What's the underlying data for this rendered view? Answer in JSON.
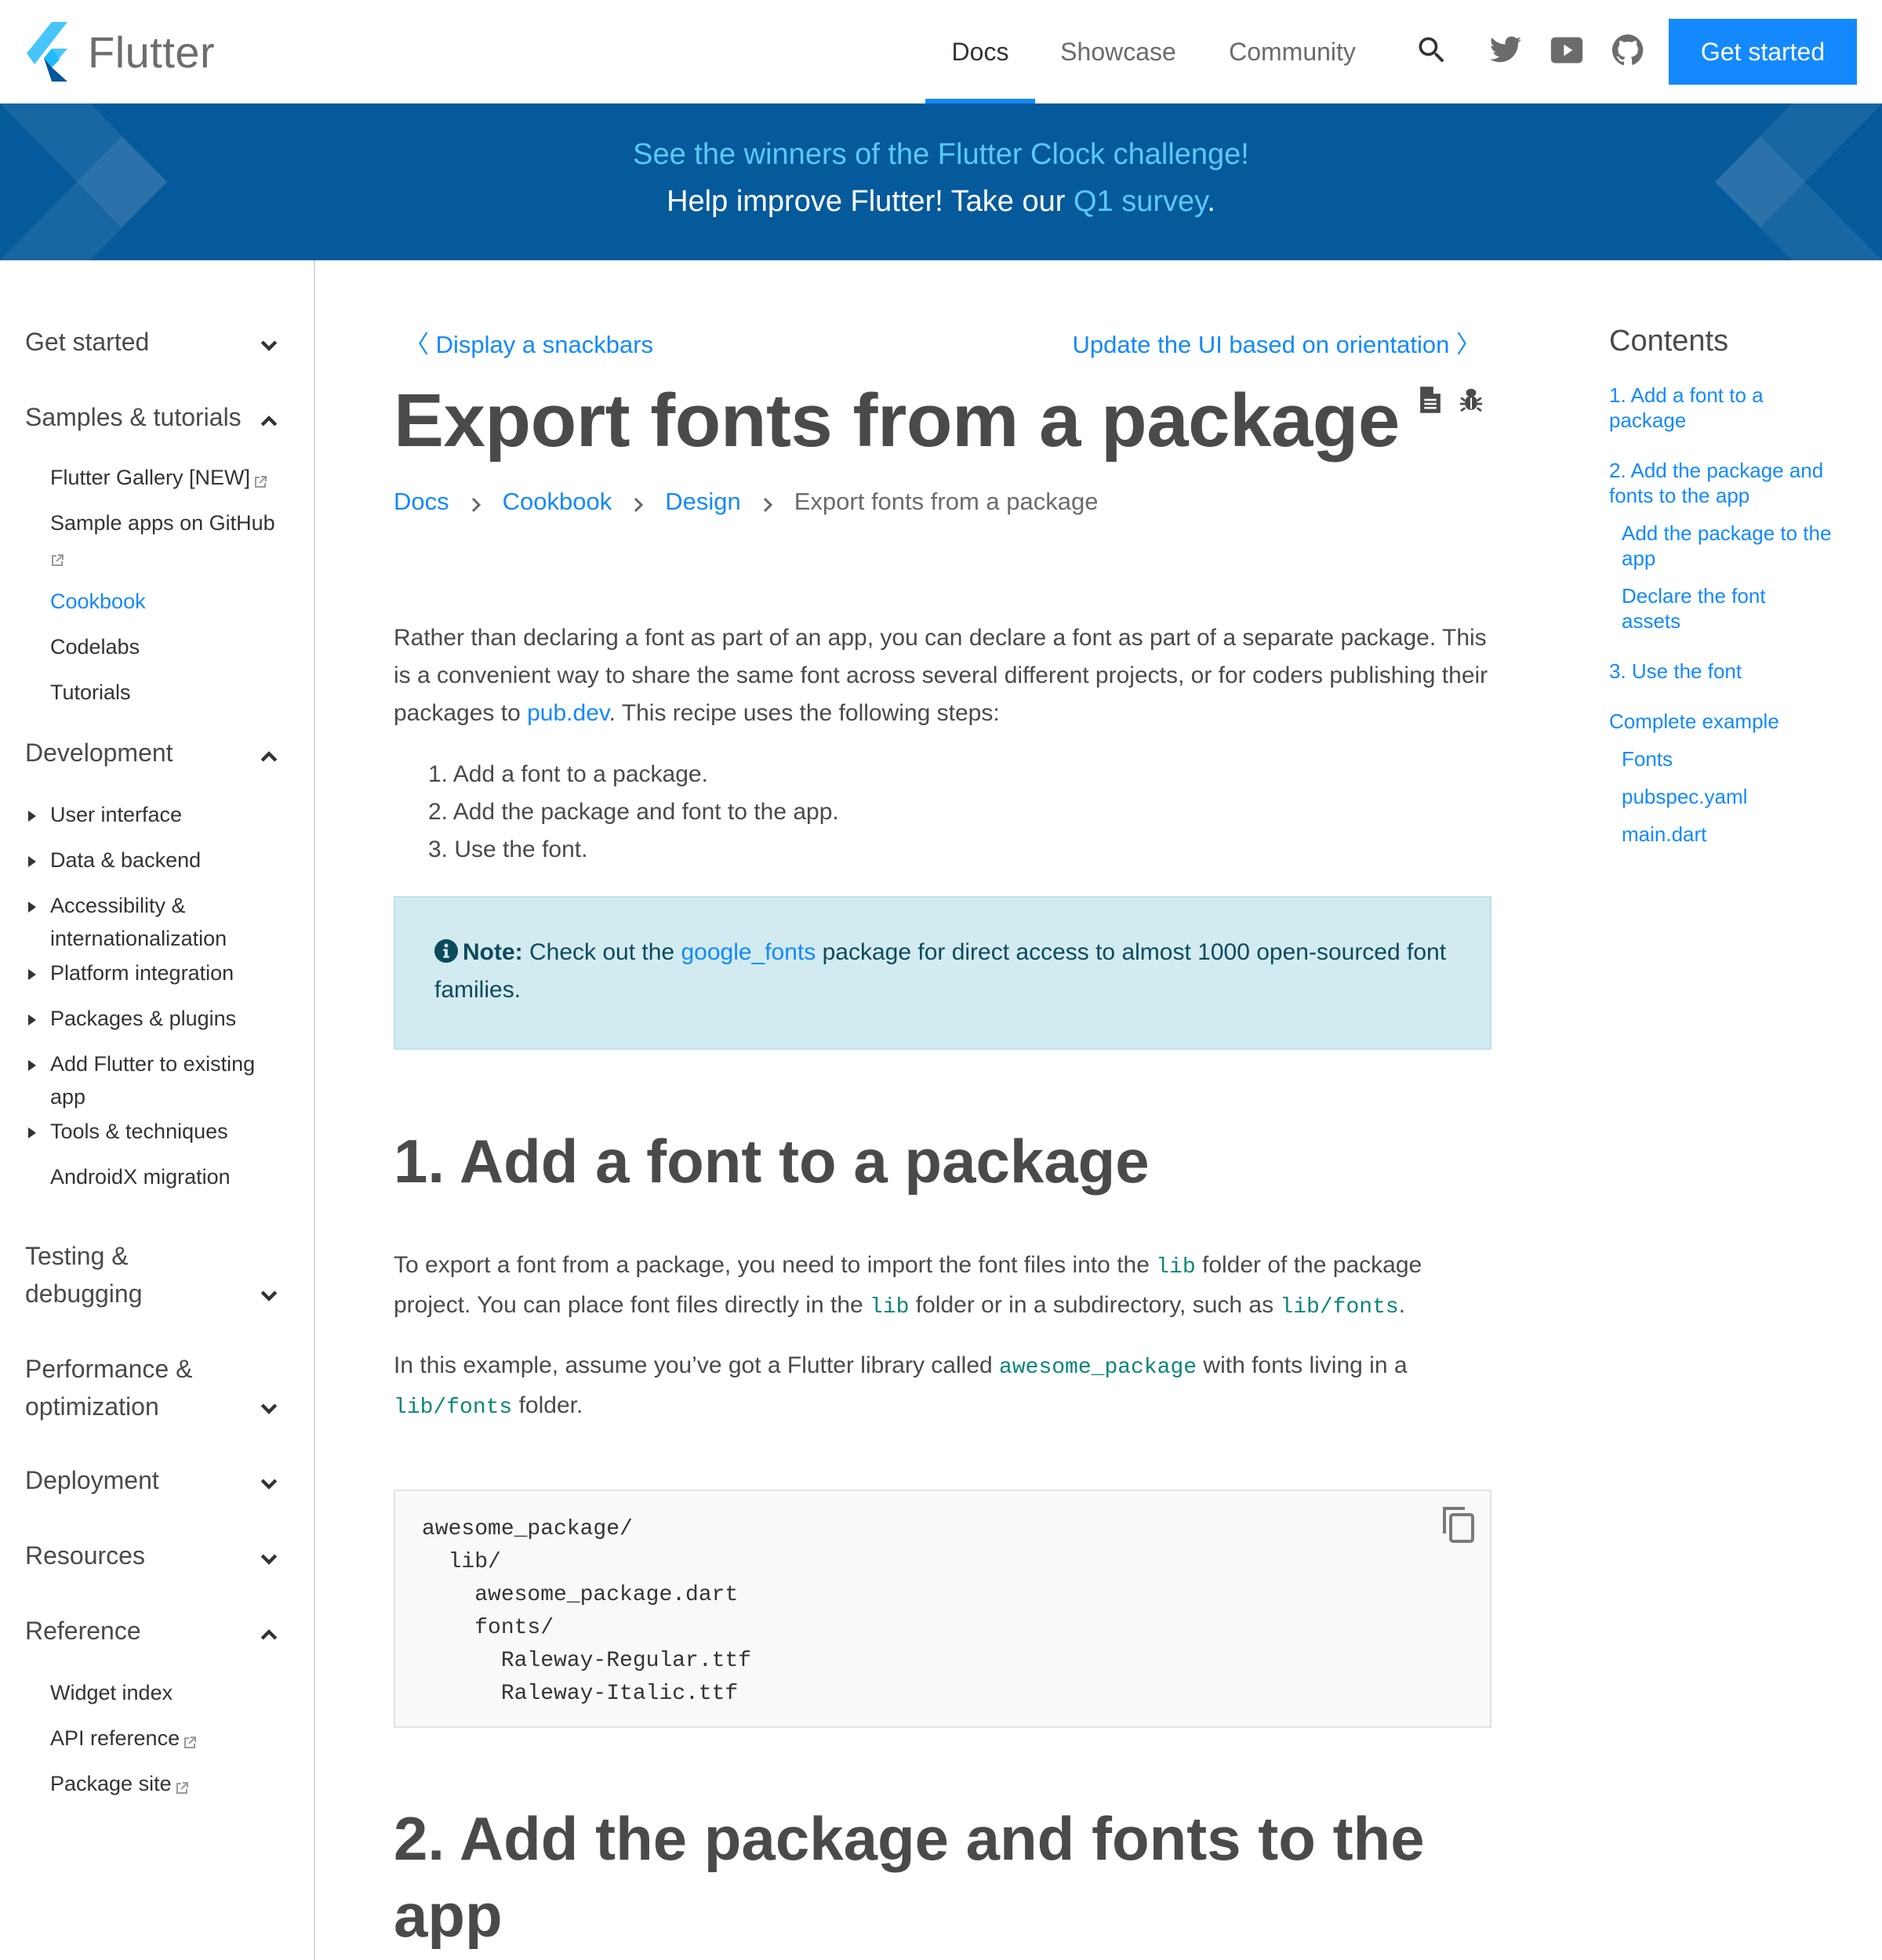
{
  "header": {
    "logo_text": "Flutter",
    "nav": [
      {
        "label": "Docs",
        "active": true
      },
      {
        "label": "Showcase",
        "active": false
      },
      {
        "label": "Community",
        "active": false
      }
    ],
    "icons": [
      "search-icon",
      "twitter-icon",
      "youtube-icon",
      "github-icon"
    ],
    "cta_label": "Get started"
  },
  "banner": {
    "line1": "See the winners of the Flutter Clock challenge!",
    "line2_prefix": "Help improve Flutter! Take our ",
    "line2_link": "Q1 survey",
    "line2_suffix": "."
  },
  "sidebar": {
    "sections": [
      {
        "label": "Get started",
        "expanded": false
      },
      {
        "label": "Samples & tutorials",
        "expanded": true,
        "items": [
          {
            "label": "Flutter Gallery [NEW]",
            "external": true
          },
          {
            "label": "Sample apps on GitHub",
            "external": true
          },
          {
            "label": "Cookbook",
            "active": true
          },
          {
            "label": "Codelabs"
          },
          {
            "label": "Tutorials"
          }
        ]
      },
      {
        "label": "Development",
        "expanded": true,
        "items": [
          {
            "label": "User interface",
            "collapsible": true
          },
          {
            "label": "Data & backend",
            "collapsible": true
          },
          {
            "label": "Accessibility & internationalization",
            "collapsible": true
          },
          {
            "label": "Platform integration",
            "collapsible": true
          },
          {
            "label": "Packages & plugins",
            "collapsible": true
          },
          {
            "label": "Add Flutter to existing app",
            "collapsible": true
          },
          {
            "label": "Tools & techniques",
            "collapsible": true
          },
          {
            "label": "AndroidX migration"
          }
        ]
      },
      {
        "label": "Testing & debugging",
        "expanded": false
      },
      {
        "label": "Performance & optimization",
        "expanded": false
      },
      {
        "label": "Deployment",
        "expanded": false
      },
      {
        "label": "Resources",
        "expanded": false
      },
      {
        "label": "Reference",
        "expanded": true,
        "items": [
          {
            "label": "Widget index"
          },
          {
            "label": "API reference",
            "external": true
          },
          {
            "label": "Package site",
            "external": true
          }
        ]
      }
    ]
  },
  "main": {
    "prev_link": "Display a snackbars",
    "next_link": "Update the UI based on orientation",
    "title": "Export fonts from a package",
    "title_icons": [
      "document-icon",
      "bug-icon"
    ],
    "breadcrumb": [
      {
        "label": "Docs",
        "link": true
      },
      {
        "label": "Cookbook",
        "link": true
      },
      {
        "label": "Design",
        "link": true
      },
      {
        "label": "Export fonts from a package",
        "link": false
      }
    ],
    "intro": {
      "text1": "Rather than declaring a font as part of an app, you can declare a font as part of a separate package. This is a convenient way to share the same font across several different projects, or for coders publishing their packages to ",
      "link": "pub.dev",
      "text2": ". This recipe uses the following steps:"
    },
    "steps": [
      "1. Add a font to a package.",
      "2. Add the package and font to the app.",
      "3. Use the font."
    ],
    "note": {
      "label": "Note:",
      "text1": " Check out the ",
      "link": "google_fonts",
      "text2": " package for direct access to almost 1000 open-sourced font families."
    },
    "section1": {
      "heading": "1. Add a font to a package",
      "p1_a": "To export a font from a package, you need to import the font files into the ",
      "p1_code1": "lib",
      "p1_b": " folder of the package project. You can place font files directly in the ",
      "p1_code2": "lib",
      "p1_c": " folder or in a subdirectory, such as ",
      "p1_code3": "lib/fonts",
      "p1_d": ".",
      "p2_a": "In this example, assume you’ve got a Flutter library called ",
      "p2_code1": "awesome_package",
      "p2_b": " with fonts living in a ",
      "p2_code2": "lib/fonts",
      "p2_c": " folder."
    },
    "code_block": "awesome_package/\n  lib/\n    awesome_package.dart\n    fonts/\n      Raleway-Regular.ttf\n      Raleway-Italic.ttf",
    "section2": {
      "heading": "2. Add the package and fonts to the app"
    }
  },
  "toc": {
    "title": "Contents",
    "items": [
      {
        "label": "1. Add a font to a package",
        "level": 1
      },
      {
        "label": "2. Add the package and fonts to the app",
        "level": 1
      },
      {
        "label": "Add the package to the app",
        "level": 2
      },
      {
        "label": "Declare the font assets",
        "level": 2
      },
      {
        "label": "3. Use the font",
        "level": 1
      },
      {
        "label": "Complete example",
        "level": 1
      },
      {
        "label": "Fonts",
        "level": 2
      },
      {
        "label": "pubspec.yaml",
        "level": 2
      },
      {
        "label": "main.dart",
        "level": 2
      }
    ]
  },
  "colors": {
    "accent": "#1389fd",
    "banner_bg": "#055a9b",
    "banner_link": "#5cc8f8",
    "note_bg": "#d2ebf1",
    "note_text": "#0c4a5b",
    "inline_code": "#0a8577",
    "code_bg": "#f8f9fa"
  }
}
